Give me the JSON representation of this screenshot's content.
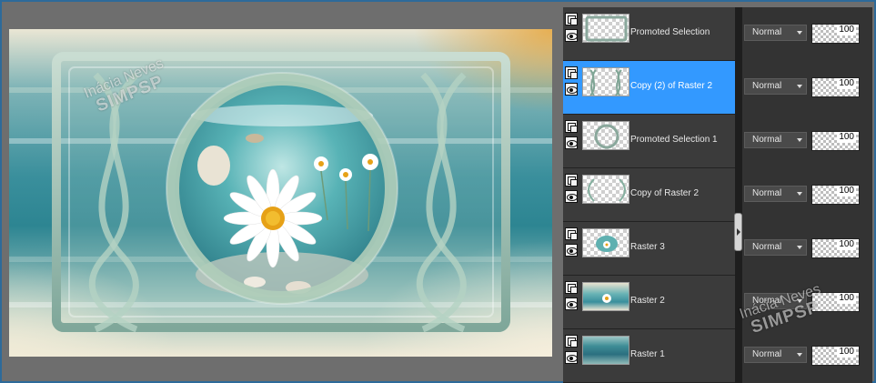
{
  "watermark": {
    "line1": "Inácia Neves",
    "line2": "SIMPSP"
  },
  "colors": {
    "selected": "#3399ff",
    "panel": "#3b3b3b",
    "background": "#2d6a9a"
  },
  "layers": [
    {
      "name": "Promoted Selection",
      "blend": "Normal",
      "opacity": "100",
      "selected": false,
      "thumb": "frame"
    },
    {
      "name": "Copy (2) of Raster 2",
      "blend": "Normal",
      "opacity": "100",
      "selected": true,
      "thumb": "twists"
    },
    {
      "name": "Promoted Selection 1",
      "blend": "Normal",
      "opacity": "100",
      "selected": false,
      "thumb": "ring"
    },
    {
      "name": "Copy of Raster 2",
      "blend": "Normal",
      "opacity": "100",
      "selected": false,
      "thumb": "arcs"
    },
    {
      "name": "Raster 3",
      "blend": "Normal",
      "opacity": "100",
      "selected": false,
      "thumb": "daisy"
    },
    {
      "name": "Raster 2",
      "blend": "Normal",
      "opacity": "100",
      "selected": false,
      "thumb": "scene"
    },
    {
      "name": "Raster 1",
      "blend": "Normal",
      "opacity": "100",
      "selected": false,
      "thumb": "gradient"
    }
  ],
  "icons": {
    "link": "layer-link-icon",
    "visibility": "eye-icon",
    "dropdown": "chevron-down-icon"
  }
}
